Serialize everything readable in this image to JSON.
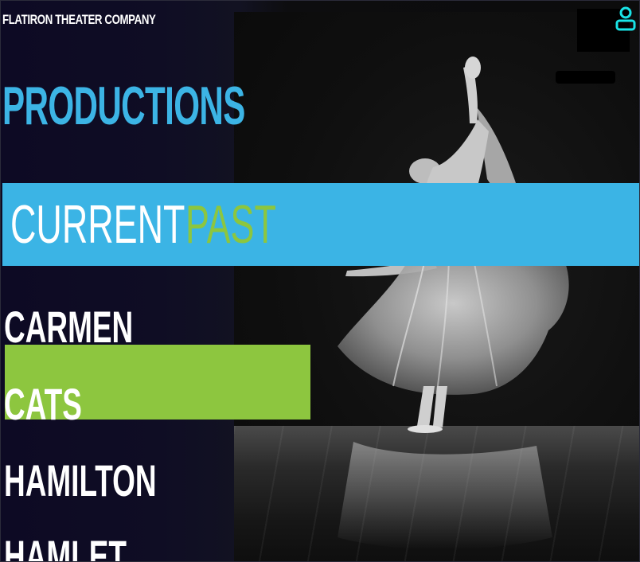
{
  "header": {
    "brand": "FLATIRON THEATER COMPANY",
    "user_icon": "user-icon"
  },
  "page": {
    "title": "PRODUCTIONS"
  },
  "tabs": [
    {
      "label": "CURRENT",
      "color": "#ffffff"
    },
    {
      "label": "PAST",
      "color": "#8cc63f"
    }
  ],
  "productions": [
    {
      "title": "CARMEN",
      "selected": false
    },
    {
      "title": "CATS",
      "selected": true
    },
    {
      "title": "HAMILTON",
      "selected": false
    },
    {
      "title": "HAMLET",
      "selected": false
    }
  ],
  "colors": {
    "accent_blue": "#3bb4e5",
    "accent_green": "#8dc63f",
    "icon_cyan": "#19e3e6",
    "background": "#0c0b1f"
  }
}
